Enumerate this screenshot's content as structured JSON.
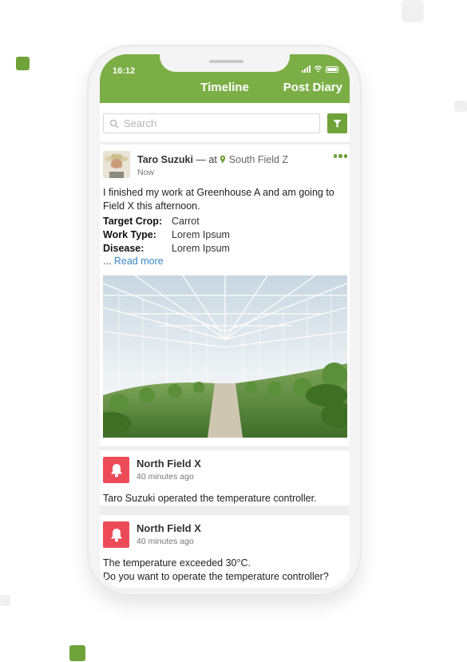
{
  "status_bar": {
    "time": "16:12"
  },
  "header": {
    "title": "Timeline",
    "post_diary_label": "Post Diary"
  },
  "search": {
    "placeholder": "Search"
  },
  "post": {
    "author": "Taro Suzuki",
    "at_label": "— at",
    "location": "South Field Z",
    "time": "Now",
    "body": "I finished my work at Greenhouse A and am going to Field X this afternoon.",
    "fields": [
      {
        "label": "Target Crop:",
        "value": "Carrot"
      },
      {
        "label": "Work Type:",
        "value": "Lorem Ipsum"
      },
      {
        "label": "Disease:",
        "value": "Lorem Ipsum"
      }
    ],
    "ellipsis": "...",
    "read_more": "Read more"
  },
  "notifications": [
    {
      "title": "North Field X",
      "time": "40 minutes ago",
      "lines": [
        "Taro Suzuki operated the temperature controller."
      ]
    },
    {
      "title": "North Field X",
      "time": "40 minutes ago",
      "lines": [
        "The temperature exceeded 30°C.",
        "Do you want to operate the temperature controller?"
      ]
    }
  ],
  "colors": {
    "brand_green": "#7cae46",
    "accent_green": "#6fa33a",
    "alert_red": "#ec4a57",
    "link_blue": "#3b86c6"
  },
  "icons": [
    "search-icon",
    "filter-icon",
    "location-pin-icon",
    "more-dots-icon",
    "bell-icon",
    "signal-icon",
    "wifi-icon",
    "battery-icon"
  ]
}
